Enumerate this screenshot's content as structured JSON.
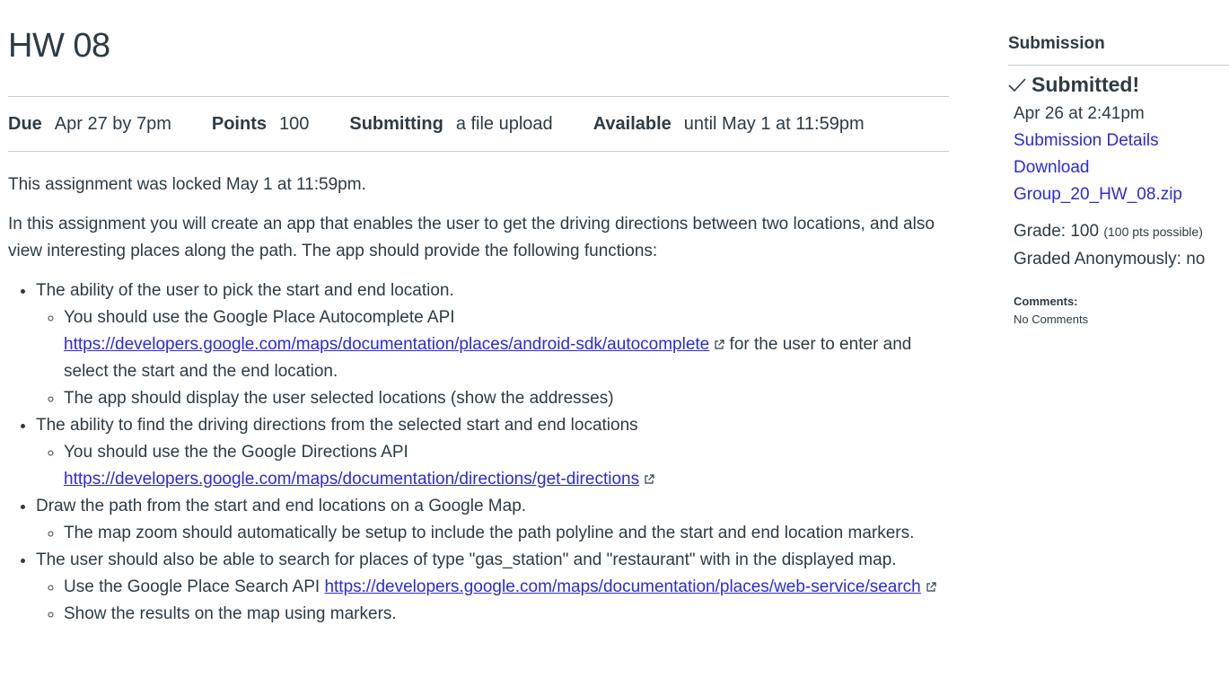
{
  "assignment": {
    "title": "HW 08",
    "details": {
      "due_label": "Due",
      "due_value": "Apr 27 by 7pm",
      "points_label": "Points",
      "points_value": "100",
      "submitting_label": "Submitting",
      "submitting_value": "a file upload",
      "available_label": "Available",
      "available_value": "until May 1 at 11:59pm"
    },
    "locked_notice": "This assignment was locked May 1 at 11:59pm.",
    "intro": "In this assignment you will create an app that enables the user to get the driving directions between two locations, and also view interesting places along the path. The app should provide the following functions:",
    "items": [
      {
        "text": "The ability of the user to pick the start and end location.",
        "sub": {
          "s1_text": "You should use the Google Place Autocomplete API",
          "s1_link": "https://developers.google.com/maps/documentation/places/android-sdk/autocomplete",
          "s1_after": "for the user to enter and select the start and the end location.",
          "s2_text": "The app should display the user selected locations (show the addresses)"
        }
      },
      {
        "text": "The ability to find the driving directions from the selected start and end locations",
        "sub": {
          "s1_text": "You should use the the Google Directions API",
          "s1_link": "https://developers.google.com/maps/documentation/directions/get-directions"
        }
      },
      {
        "text": "Draw the path from the start and end locations on a Google Map.",
        "sub": {
          "s1_text": "The map zoom should automatically be setup to include the path polyline and the start and end location markers."
        }
      },
      {
        "text": "The user should also be able to search for places of type \"gas_station\" and \"restaurant\" with in the displayed map.",
        "sub": {
          "s1_text": "Use the Google Place Search API",
          "s1_link": "https://developers.google.com/maps/documentation/places/web-service/search",
          "s2_text": "Show the results on the map using markers."
        }
      }
    ]
  },
  "sidebar": {
    "header": "Submission",
    "status": "Submitted!",
    "submitted_at": "Apr 26 at 2:41pm",
    "details_link": "Submission Details",
    "download_label": "Download",
    "file_name": "Group_20_HW_08.zip",
    "grade_label": "Grade: 100",
    "grade_possible": "(100 pts possible)",
    "graded_anon": "Graded Anonymously: no",
    "comments_label": "Comments:",
    "comments_value": "No Comments"
  },
  "colors": {
    "text": "#2d3b45",
    "link": "#2b2bd6",
    "divider": "#c7cdd1"
  }
}
